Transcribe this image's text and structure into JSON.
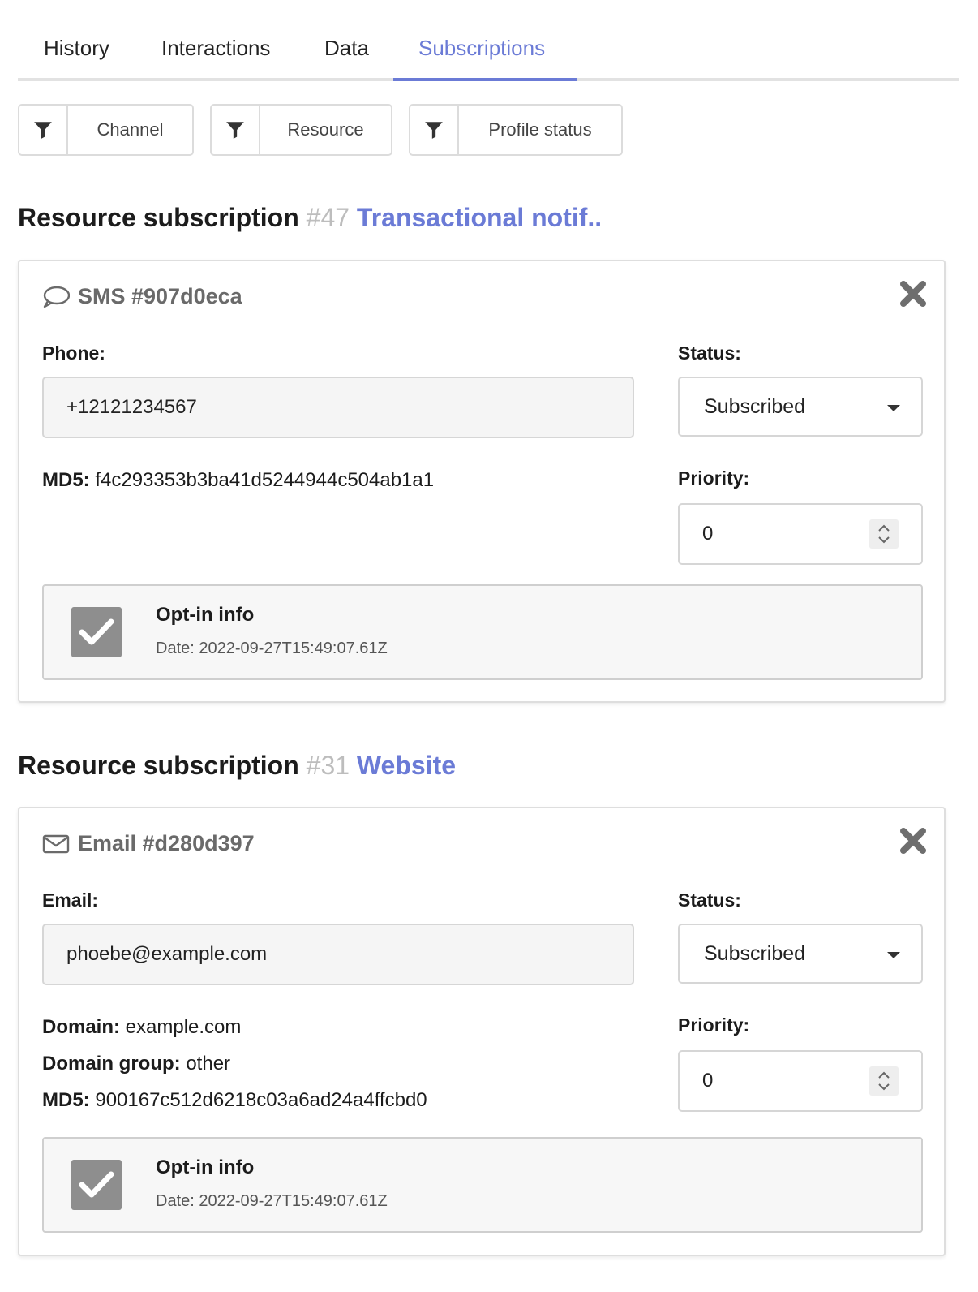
{
  "tabs": [
    {
      "label": "History"
    },
    {
      "label": "Interactions"
    },
    {
      "label": "Data"
    },
    {
      "label": "Subscriptions",
      "active": true
    }
  ],
  "filters": [
    {
      "label": "Channel",
      "icon": "filter-icon"
    },
    {
      "label": "Resource",
      "icon": "filter-icon"
    },
    {
      "label": "Profile status",
      "icon": "filter-icon"
    }
  ],
  "colors": {
    "accent": "#6b7bd6",
    "muted": "#bdbdbd",
    "checkbox": "#8e8e8e"
  },
  "subscriptions": [
    {
      "section_label": "Resource subscription",
      "resource_id": "#47",
      "resource_name": "Transactional notif..",
      "channel": {
        "icon": "speech-bubble-icon",
        "title": "SMS #907d0eca"
      },
      "contact_label": "Phone:",
      "contact_value": "+12121234567",
      "status_label": "Status:",
      "status_value": "Subscribed",
      "priority_label": "Priority:",
      "priority_value": "0",
      "meta": [
        {
          "key": "MD5:",
          "value": "f4c293353b3ba41d5244944c504ab1a1"
        }
      ],
      "optin": {
        "title": "Opt-in info",
        "date": "Date: 2022-09-27T15:49:07.61Z"
      }
    },
    {
      "section_label": "Resource subscription",
      "resource_id": "#31",
      "resource_name": "Website",
      "channel": {
        "icon": "envelope-icon",
        "title": "Email #d280d397"
      },
      "contact_label": "Email:",
      "contact_value": "phoebe@example.com",
      "status_label": "Status:",
      "status_value": "Subscribed",
      "priority_label": "Priority:",
      "priority_value": "0",
      "meta": [
        {
          "key": "Domain:",
          "value": "example.com"
        },
        {
          "key": "Domain group:",
          "value": "other"
        },
        {
          "key": "MD5:",
          "value": "900167c512d6218c03a6ad24a4ffcbd0"
        }
      ],
      "optin": {
        "title": "Opt-in info",
        "date": "Date: 2022-09-27T15:49:07.61Z"
      }
    }
  ]
}
